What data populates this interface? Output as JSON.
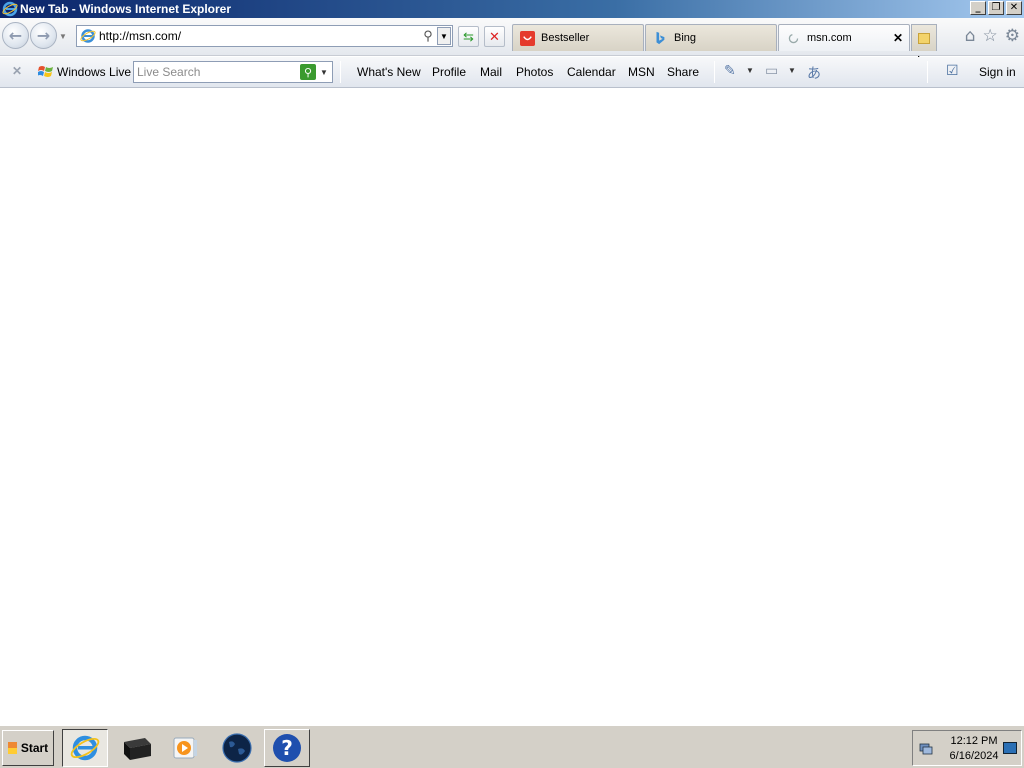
{
  "window": {
    "title": "New Tab - Windows Internet Explorer",
    "buttons": [
      "minimize",
      "restore",
      "close"
    ]
  },
  "navigation": {
    "address": "http://msn.com/"
  },
  "tabs": [
    {
      "label": "Bestseller",
      "icon": "bestseller-icon"
    },
    {
      "label": "Bing",
      "icon": "bing-icon"
    },
    {
      "label": "msn.com",
      "icon": "loading-icon",
      "active": true
    }
  ],
  "toolbar": {
    "windows_live": "Windows Live",
    "search_placeholder": "Live Search",
    "links": [
      "What's New",
      "Profile",
      "Mail",
      "Photos",
      "Calendar",
      "MSN",
      "Share"
    ],
    "sign_in": "Sign in"
  },
  "taskbar": {
    "start_label": "Start",
    "time": "12:12 PM",
    "date": "6/16/2024"
  },
  "colors": {
    "titlebar_start": "#0a246a",
    "taskbar": "#d4d0c8",
    "search_go": "#3a9a2f"
  }
}
